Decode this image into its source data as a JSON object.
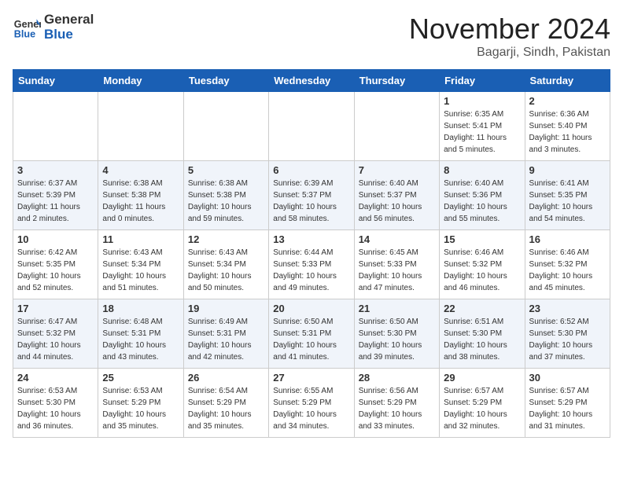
{
  "logo": {
    "line1": "General",
    "line2": "Blue"
  },
  "title": "November 2024",
  "subtitle": "Bagarji, Sindh, Pakistan",
  "days_of_week": [
    "Sunday",
    "Monday",
    "Tuesday",
    "Wednesday",
    "Thursday",
    "Friday",
    "Saturday"
  ],
  "weeks": [
    [
      {
        "day": "",
        "info": ""
      },
      {
        "day": "",
        "info": ""
      },
      {
        "day": "",
        "info": ""
      },
      {
        "day": "",
        "info": ""
      },
      {
        "day": "",
        "info": ""
      },
      {
        "day": "1",
        "info": "Sunrise: 6:35 AM\nSunset: 5:41 PM\nDaylight: 11 hours and 5 minutes."
      },
      {
        "day": "2",
        "info": "Sunrise: 6:36 AM\nSunset: 5:40 PM\nDaylight: 11 hours and 3 minutes."
      }
    ],
    [
      {
        "day": "3",
        "info": "Sunrise: 6:37 AM\nSunset: 5:39 PM\nDaylight: 11 hours and 2 minutes."
      },
      {
        "day": "4",
        "info": "Sunrise: 6:38 AM\nSunset: 5:38 PM\nDaylight: 11 hours and 0 minutes."
      },
      {
        "day": "5",
        "info": "Sunrise: 6:38 AM\nSunset: 5:38 PM\nDaylight: 10 hours and 59 minutes."
      },
      {
        "day": "6",
        "info": "Sunrise: 6:39 AM\nSunset: 5:37 PM\nDaylight: 10 hours and 58 minutes."
      },
      {
        "day": "7",
        "info": "Sunrise: 6:40 AM\nSunset: 5:37 PM\nDaylight: 10 hours and 56 minutes."
      },
      {
        "day": "8",
        "info": "Sunrise: 6:40 AM\nSunset: 5:36 PM\nDaylight: 10 hours and 55 minutes."
      },
      {
        "day": "9",
        "info": "Sunrise: 6:41 AM\nSunset: 5:35 PM\nDaylight: 10 hours and 54 minutes."
      }
    ],
    [
      {
        "day": "10",
        "info": "Sunrise: 6:42 AM\nSunset: 5:35 PM\nDaylight: 10 hours and 52 minutes."
      },
      {
        "day": "11",
        "info": "Sunrise: 6:43 AM\nSunset: 5:34 PM\nDaylight: 10 hours and 51 minutes."
      },
      {
        "day": "12",
        "info": "Sunrise: 6:43 AM\nSunset: 5:34 PM\nDaylight: 10 hours and 50 minutes."
      },
      {
        "day": "13",
        "info": "Sunrise: 6:44 AM\nSunset: 5:33 PM\nDaylight: 10 hours and 49 minutes."
      },
      {
        "day": "14",
        "info": "Sunrise: 6:45 AM\nSunset: 5:33 PM\nDaylight: 10 hours and 47 minutes."
      },
      {
        "day": "15",
        "info": "Sunrise: 6:46 AM\nSunset: 5:32 PM\nDaylight: 10 hours and 46 minutes."
      },
      {
        "day": "16",
        "info": "Sunrise: 6:46 AM\nSunset: 5:32 PM\nDaylight: 10 hours and 45 minutes."
      }
    ],
    [
      {
        "day": "17",
        "info": "Sunrise: 6:47 AM\nSunset: 5:32 PM\nDaylight: 10 hours and 44 minutes."
      },
      {
        "day": "18",
        "info": "Sunrise: 6:48 AM\nSunset: 5:31 PM\nDaylight: 10 hours and 43 minutes."
      },
      {
        "day": "19",
        "info": "Sunrise: 6:49 AM\nSunset: 5:31 PM\nDaylight: 10 hours and 42 minutes."
      },
      {
        "day": "20",
        "info": "Sunrise: 6:50 AM\nSunset: 5:31 PM\nDaylight: 10 hours and 41 minutes."
      },
      {
        "day": "21",
        "info": "Sunrise: 6:50 AM\nSunset: 5:30 PM\nDaylight: 10 hours and 39 minutes."
      },
      {
        "day": "22",
        "info": "Sunrise: 6:51 AM\nSunset: 5:30 PM\nDaylight: 10 hours and 38 minutes."
      },
      {
        "day": "23",
        "info": "Sunrise: 6:52 AM\nSunset: 5:30 PM\nDaylight: 10 hours and 37 minutes."
      }
    ],
    [
      {
        "day": "24",
        "info": "Sunrise: 6:53 AM\nSunset: 5:30 PM\nDaylight: 10 hours and 36 minutes."
      },
      {
        "day": "25",
        "info": "Sunrise: 6:53 AM\nSunset: 5:29 PM\nDaylight: 10 hours and 35 minutes."
      },
      {
        "day": "26",
        "info": "Sunrise: 6:54 AM\nSunset: 5:29 PM\nDaylight: 10 hours and 35 minutes."
      },
      {
        "day": "27",
        "info": "Sunrise: 6:55 AM\nSunset: 5:29 PM\nDaylight: 10 hours and 34 minutes."
      },
      {
        "day": "28",
        "info": "Sunrise: 6:56 AM\nSunset: 5:29 PM\nDaylight: 10 hours and 33 minutes."
      },
      {
        "day": "29",
        "info": "Sunrise: 6:57 AM\nSunset: 5:29 PM\nDaylight: 10 hours and 32 minutes."
      },
      {
        "day": "30",
        "info": "Sunrise: 6:57 AM\nSunset: 5:29 PM\nDaylight: 10 hours and 31 minutes."
      }
    ]
  ]
}
